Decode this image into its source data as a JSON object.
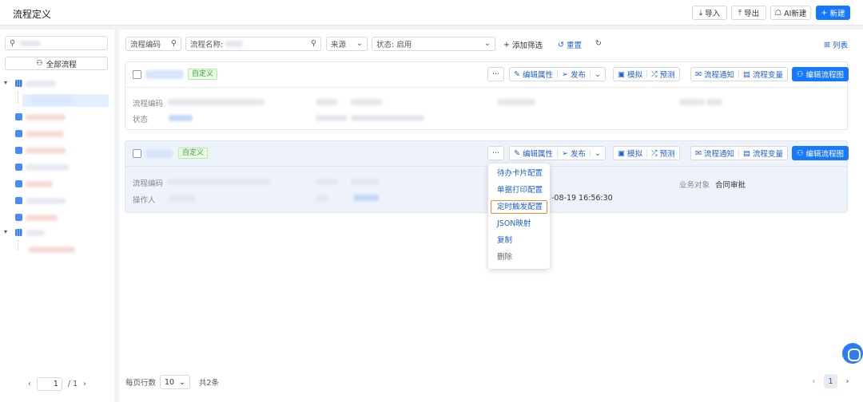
{
  "header": {
    "title": "流程定义",
    "buttons": {
      "import": "导入",
      "export": "导出",
      "ai_new": "AI新建",
      "new": "新建"
    }
  },
  "sidebar": {
    "all_flows": "全部流程",
    "pager": {
      "page": "1",
      "total": "/ 1"
    }
  },
  "toolbar": {
    "code_placeholder": "流程编码",
    "name_label": "流程名称:",
    "source": "来源",
    "status": "状态: 启用",
    "add_filter": "添加筛选",
    "reset": "重置",
    "view": "列表"
  },
  "card_actions": {
    "more": "···",
    "edit_attr": "编辑属性",
    "publish": "发布",
    "simulate": "模拟",
    "predict": "预测",
    "notify": "流程通知",
    "variables": "流程变量",
    "edit_diagram": "编辑流程图"
  },
  "cards": [
    {
      "tag": "自定义",
      "code_label": "流程编码",
      "status_label": "状态"
    },
    {
      "tag": "自定义",
      "code_label": "流程编码",
      "operator_label": "操作人",
      "time": "-08-19 16:56:30",
      "biz_label": "业务对象",
      "biz_value": "合同审批"
    }
  ],
  "menu": {
    "items": [
      "待办卡片配置",
      "单据打印配置",
      "定时触发配置",
      "JSON映射",
      "复制",
      "删除"
    ],
    "selected": "定时触发配置"
  },
  "footer": {
    "rows_label": "每页行数",
    "rows_value": "10",
    "total": "共2条",
    "current_page": "1"
  }
}
